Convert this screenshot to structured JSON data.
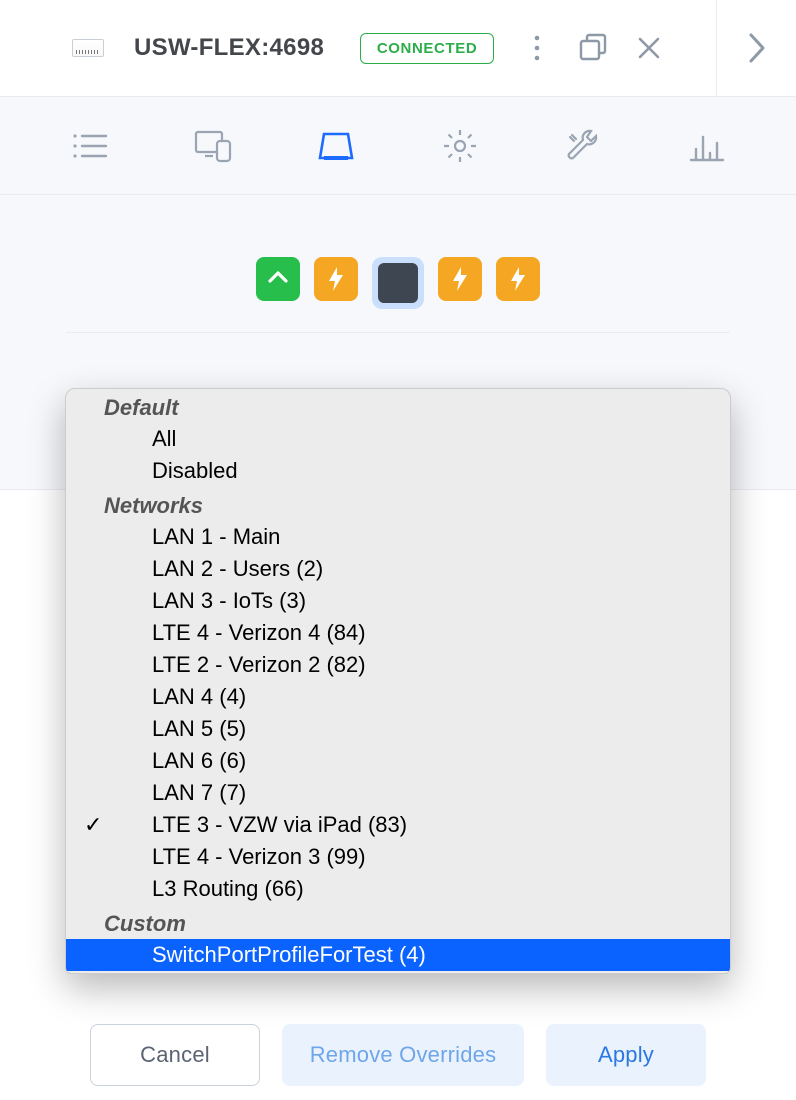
{
  "header": {
    "title": "USW-FLEX:4698",
    "status": "CONNECTED"
  },
  "dropdown": {
    "sections": [
      {
        "title": "Default",
        "items": [
          {
            "label": "All",
            "checked": false
          },
          {
            "label": "Disabled",
            "checked": false
          }
        ]
      },
      {
        "title": "Networks",
        "items": [
          {
            "label": "LAN 1 - Main",
            "checked": false
          },
          {
            "label": "LAN 2 - Users (2)",
            "checked": false
          },
          {
            "label": "LAN 3 - IoTs (3)",
            "checked": false
          },
          {
            "label": "LTE 4 - Verizon 4 (84)",
            "checked": false
          },
          {
            "label": "LTE 2 - Verizon 2 (82)",
            "checked": false
          },
          {
            "label": "LAN 4 (4)",
            "checked": false
          },
          {
            "label": "LAN 5 (5)",
            "checked": false
          },
          {
            "label": "LAN 6 (6)",
            "checked": false
          },
          {
            "label": "LAN 7 (7)",
            "checked": false
          },
          {
            "label": "LTE 3 - VZW via iPad (83)",
            "checked": true
          },
          {
            "label": "LTE 4  - Verizon 3 (99)",
            "checked": false
          },
          {
            "label": "L3 Routing (66)",
            "checked": false
          }
        ]
      },
      {
        "title": "Custom",
        "items": [
          {
            "label": "SwitchPortProfileForTest (4)",
            "checked": false,
            "highlight": true
          }
        ]
      }
    ]
  },
  "buttons": {
    "cancel": "Cancel",
    "remove": "Remove Overrides",
    "apply": "Apply"
  }
}
